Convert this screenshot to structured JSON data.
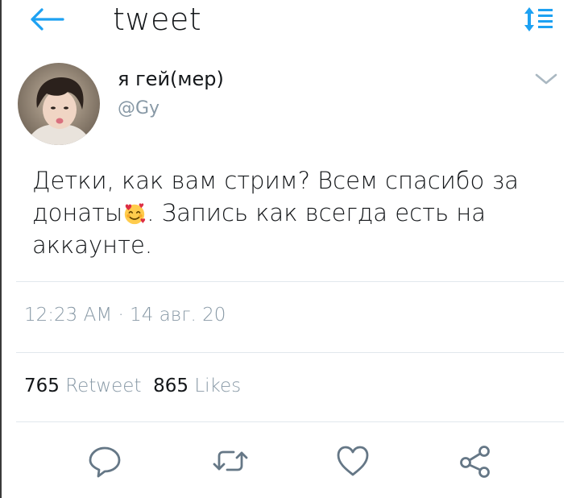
{
  "header": {
    "title": "tweet",
    "back_icon": "arrow-left-icon",
    "sort_icon": "sort-lines-icon",
    "accent_color": "#1da1f2"
  },
  "tweet": {
    "display_name": "я гей(мер)",
    "handle": "@Gy",
    "text_part1": "Детки, как вам стрим? Всем спасибо за донаты",
    "emoji": "smiling-face-with-hearts-emoji",
    "text_part2": ". Запись как всегда есть на аккаунте.",
    "time": "12:23 AM",
    "separator": "·",
    "date": "14 авг. 20"
  },
  "stats": {
    "retweets_count": "765",
    "retweets_label": "Retweet",
    "likes_count": "865",
    "likes_label": "Likes"
  },
  "actions": [
    {
      "icon": "reply-icon"
    },
    {
      "icon": "retweet-icon"
    },
    {
      "icon": "heart-icon"
    },
    {
      "icon": "share-icon"
    }
  ],
  "colors": {
    "text": "#14171a",
    "muted": "#8899a6",
    "divider": "#e1e8ed"
  }
}
